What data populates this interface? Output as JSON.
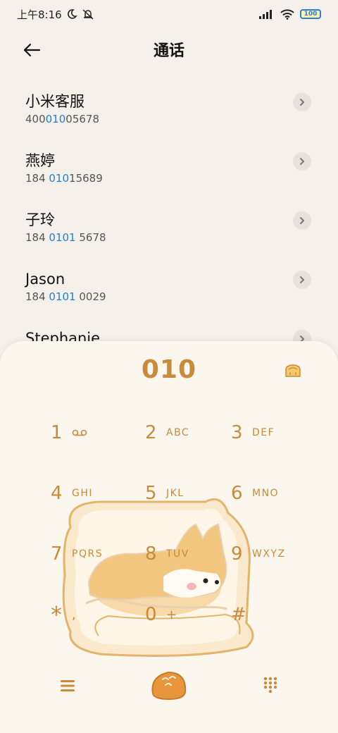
{
  "status_bar": {
    "time": "上午8:16",
    "battery": "100",
    "icons": [
      "moon-icon",
      "mute-bell-icon",
      "signal-icon",
      "wifi-icon",
      "battery-icon"
    ]
  },
  "header": {
    "title": "通话",
    "back_icon": "arrow-left-icon"
  },
  "contacts": [
    {
      "name": "小米客服",
      "number_pre": "400",
      "number_match": "010",
      "number_post": "05678"
    },
    {
      "name": "燕婷",
      "number_pre": "184 ",
      "number_match": "010",
      "number_post": "15689"
    },
    {
      "name": "子玲",
      "number_pre": "184 ",
      "number_match": "0101",
      "number_post": " 5678"
    },
    {
      "name": "Jason",
      "number_pre": "184 ",
      "number_match": "0101",
      "number_post": " 0029"
    },
    {
      "name": "Stephanie",
      "number_pre": "",
      "number_match": "",
      "number_post": ""
    }
  ],
  "dialer": {
    "number": "010",
    "keys": [
      {
        "digit": "1",
        "letters": "",
        "icon": "voicemail-icon"
      },
      {
        "digit": "2",
        "letters": "ABC"
      },
      {
        "digit": "3",
        "letters": "DEF"
      },
      {
        "digit": "4",
        "letters": "GHI"
      },
      {
        "digit": "5",
        "letters": "JKL"
      },
      {
        "digit": "6",
        "letters": "MNO"
      },
      {
        "digit": "7",
        "letters": "PQRS"
      },
      {
        "digit": "8",
        "letters": "TUV"
      },
      {
        "digit": "9",
        "letters": "WXYZ"
      },
      {
        "digit": "*",
        "letters": ","
      },
      {
        "digit": "0",
        "letters": "+"
      },
      {
        "digit": "#",
        "letters": ""
      }
    ]
  },
  "colors": {
    "accent": "#c98a3a",
    "match_highlight": "#1d7fd6",
    "background": "#f5f0e9",
    "dialer_background": "#fcf7ee"
  }
}
